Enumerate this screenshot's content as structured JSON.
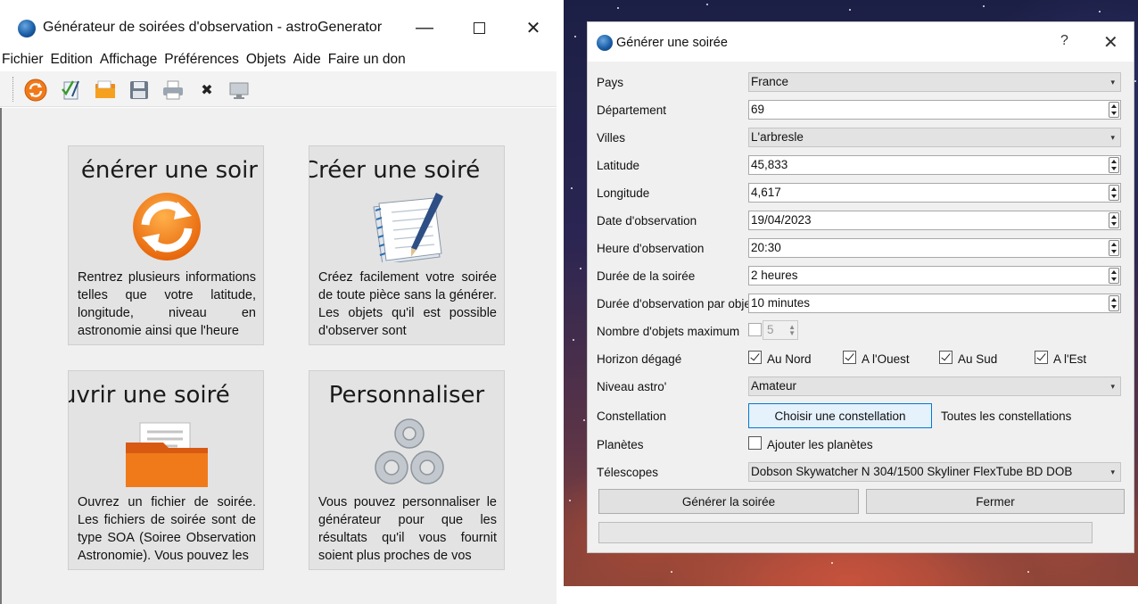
{
  "main_window": {
    "title": "Générateur de soirées d'observation - astroGenerator",
    "controls": {
      "minimize": "—",
      "close": "✕"
    },
    "menu": [
      "Fichier",
      "Edition",
      "Affichage",
      "Préférences",
      "Objets",
      "Aide",
      "Faire un don"
    ],
    "toolbar": [
      "refresh-icon",
      "checklist-icon",
      "open-folder-icon",
      "save-icon",
      "print-icon",
      "delete-icon",
      "monitor-icon"
    ],
    "toolbar_delete_glyph": "✖",
    "cards": [
      {
        "title": "énérer une soir",
        "text": "Rentrez plusieurs informations telles que votre latitude, longitude, niveau en astronomie ainsi que l'heure",
        "icon": "refresh-icon"
      },
      {
        "title": "Créer une soiré",
        "text": "Créez facilement votre soirée de toute pièce sans la générer. Les objets qu'il est possible d'observer sont",
        "icon": "notebook-pen-icon"
      },
      {
        "title": "uvrir une soiré",
        "text": "Ouvrez un fichier de soirée. Les fichiers de soirée sont de type SOA (Soiree Observation Astronomie). Vous pouvez les",
        "icon": "open-folder-icon"
      },
      {
        "title": "Personnaliser",
        "text": "Vous pouvez personnaliser le générateur pour que les résultats qu'il vous fournit soient plus proches de vos",
        "icon": "gears-icon"
      }
    ]
  },
  "dialog": {
    "title": "Générer une soirée",
    "help": "?",
    "close": "✕",
    "rows": {
      "pays": {
        "label": "Pays",
        "value": "France"
      },
      "departement": {
        "label": "Département",
        "value": "69"
      },
      "villes": {
        "label": "Villes",
        "value": "L'arbresle"
      },
      "latitude": {
        "label": "Latitude",
        "value": "45,833"
      },
      "longitude": {
        "label": "Longitude",
        "value": "4,617"
      },
      "date": {
        "label": "Date d'observation",
        "value": "19/04/2023"
      },
      "heure": {
        "label": "Heure d'observation",
        "value": "20:30"
      },
      "duree": {
        "label": "Durée de la soirée",
        "value": "2 heures"
      },
      "duree_objet": {
        "label": "Durée d'observation par objet",
        "value": "10 minutes"
      },
      "nb_objets": {
        "label": "Nombre d'objets maximum",
        "value": "5",
        "checked": false
      },
      "horizon": {
        "label": "Horizon dégagé",
        "options": [
          {
            "label": "Au Nord",
            "checked": true
          },
          {
            "label": "A l'Ouest",
            "checked": true
          },
          {
            "label": "Au Sud",
            "checked": true
          },
          {
            "label": "A l'Est",
            "checked": true
          }
        ]
      },
      "niveau": {
        "label": "Niveau astro'",
        "value": "Amateur"
      },
      "constellation": {
        "label": "Constellation",
        "button": "Choisir une constellation",
        "value": "Toutes les constellations"
      },
      "planetes": {
        "label": "Planètes",
        "checkbox_label": "Ajouter les planètes",
        "checked": false
      },
      "telescopes": {
        "label": "Télescopes",
        "value": "Dobson Skywatcher N 304/1500 Skyliner FlexTube BD DOB"
      }
    },
    "buttons": {
      "generate": "Générer la soirée",
      "close": "Fermer"
    },
    "arrow_glyph": "▾",
    "spin_glyphs": {
      "up": "▲",
      "down": "▼"
    }
  }
}
